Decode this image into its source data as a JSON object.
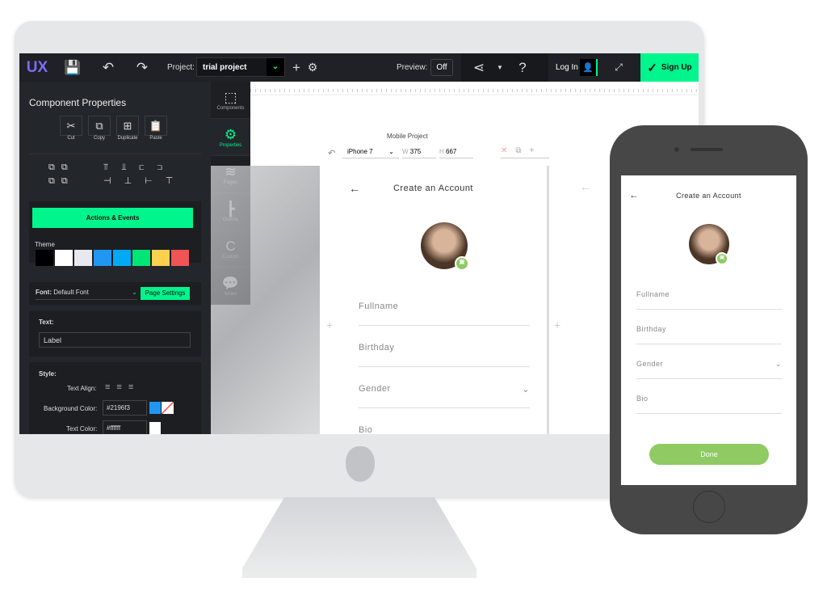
{
  "toolbar": {
    "logo": "UX",
    "project_label": "Project:",
    "project_value": "trial project",
    "preview_label": "Preview:",
    "preview_value": "Off",
    "login": "Log In",
    "signup": "Sign Up"
  },
  "panel": {
    "title": "Component Properties",
    "clipboard": [
      {
        "label": "Cut",
        "icon": "✂"
      },
      {
        "label": "Copy",
        "icon": "⧉"
      },
      {
        "label": "Duplicate",
        "icon": "⊞"
      },
      {
        "label": "Paste",
        "icon": "📋"
      }
    ],
    "actions_label": "Actions & Events",
    "theme_label": "Theme",
    "theme_colors": [
      "#000000",
      "#ffffff",
      "#e8e9ee",
      "#2196f3",
      "#03a9f4",
      "#00e676",
      "#fdd04f",
      "#f05454"
    ],
    "font_label": "Font:",
    "font_value": "Default Font",
    "page_settings": "Page Settings",
    "text_label": "Text:",
    "text_value": "Label",
    "style_label": "Style:",
    "text_align_label": "Text Align:",
    "bg_color_label": "Background Color:",
    "bg_color_value": "#2196f3",
    "text_color_label": "Text Color:",
    "text_color_value": "#ffffff"
  },
  "side_tabs": [
    {
      "label": "Components",
      "icon": "⬚"
    },
    {
      "label": "Properties",
      "icon": "⚙"
    },
    {
      "label": "Pages",
      "icon": "≋"
    },
    {
      "label": "Outline",
      "icon": "┣"
    },
    {
      "label": "Custom",
      "icon": "C"
    },
    {
      "label": "Notes",
      "icon": "💬"
    }
  ],
  "canvas": {
    "project_name": "Mobile Project",
    "device": "iPhone 7",
    "w_label": "W",
    "w_value": "375",
    "h_label": "H",
    "h_value": "667"
  },
  "mockup": {
    "title": "Create an Account",
    "fields": [
      "Fullname",
      "Birthday",
      "Gender",
      "Bio"
    ],
    "done": "Done"
  },
  "colors": {
    "accent": "#00f58c",
    "dark": "#1f2126",
    "done": "#8fca63"
  }
}
